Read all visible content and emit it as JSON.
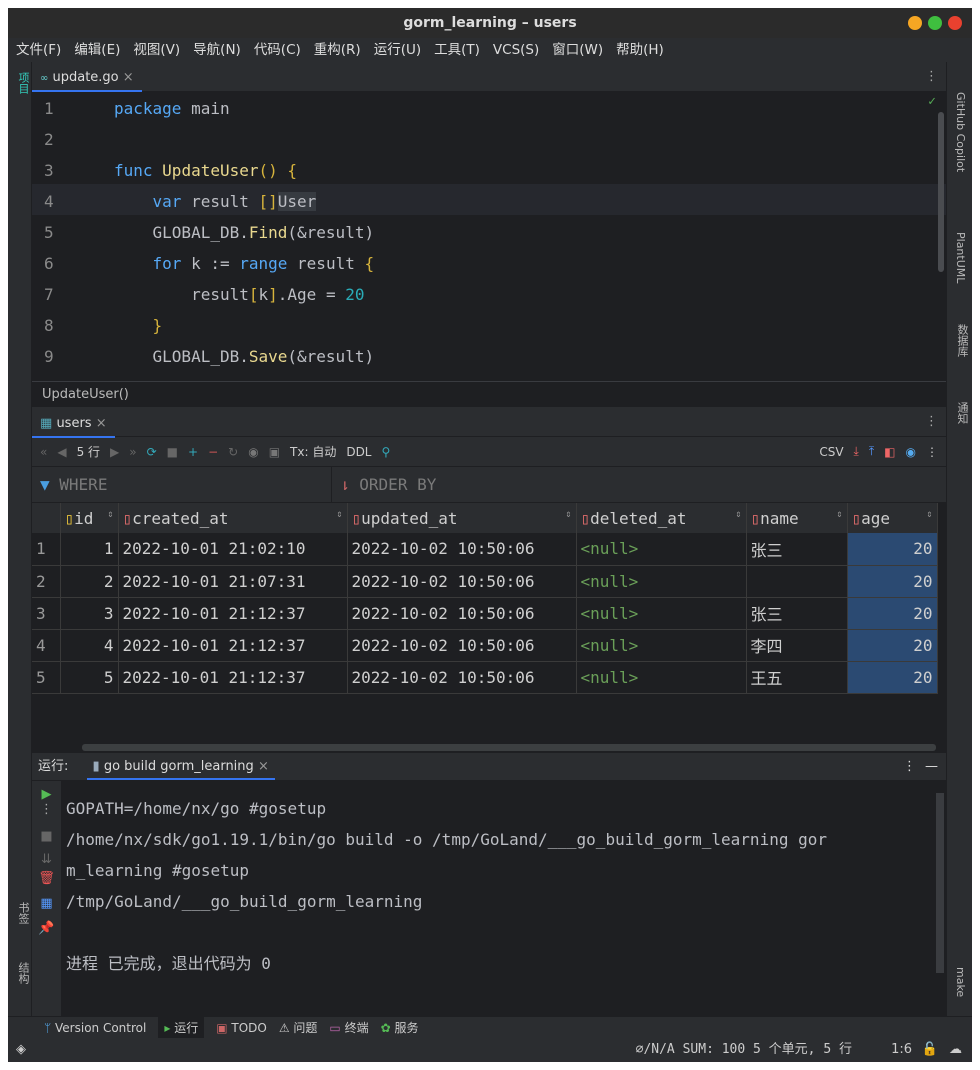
{
  "window": {
    "title": "gorm_learning – users"
  },
  "menu": [
    "文件(F)",
    "编辑(E)",
    "视图(V)",
    "导航(N)",
    "代码(C)",
    "重构(R)",
    "运行(U)",
    "工具(T)",
    "VCS(S)",
    "窗口(W)",
    "帮助(H)"
  ],
  "left_strip": {
    "project": "项目",
    "bookmarks": "书签",
    "structure": "结构"
  },
  "right_strip": {
    "copilot": "GitHub Copilot",
    "plantuml": "PlantUML",
    "database": "数据库",
    "notifications": "通知",
    "make": "make"
  },
  "editor": {
    "tab": "update.go",
    "breadcrumb": "UpdateUser()",
    "lines": [
      [
        [
          "kw",
          "package"
        ],
        [
          "p",
          " main"
        ]
      ],
      [],
      [
        [
          "kw",
          "func"
        ],
        [
          "p",
          " "
        ],
        [
          "fn",
          "UpdateUser"
        ],
        [
          "br",
          "()"
        ],
        [
          "p",
          " "
        ],
        [
          "br",
          "{"
        ]
      ],
      [
        [
          "p",
          "    "
        ],
        [
          "kw",
          "var"
        ],
        [
          "p",
          " result "
        ],
        [
          "br",
          "[]"
        ],
        [
          "hl",
          "User"
        ]
      ],
      [
        [
          "p",
          "    GLOBAL_DB."
        ],
        [
          "fn",
          "Find"
        ],
        [
          "p",
          "(&result)"
        ]
      ],
      [
        [
          "p",
          "    "
        ],
        [
          "kw",
          "for"
        ],
        [
          "p",
          " k := "
        ],
        [
          "kw",
          "range"
        ],
        [
          "p",
          " result "
        ],
        [
          "br",
          "{"
        ]
      ],
      [
        [
          "p",
          "        result"
        ],
        [
          "br",
          "["
        ],
        [
          "p",
          "k"
        ],
        [
          "br",
          "]"
        ],
        [
          "p",
          ".Age = "
        ],
        [
          "num",
          "20"
        ]
      ],
      [
        [
          "p",
          "    "
        ],
        [
          "br",
          "}"
        ]
      ],
      [
        [
          "p",
          "    GLOBAL_DB."
        ],
        [
          "fn",
          "Save"
        ],
        [
          "p",
          "(&result)"
        ]
      ]
    ]
  },
  "db": {
    "tab": "users",
    "rows_label": "5 行",
    "tx": "Tx: 自动",
    "ddl": "DDL",
    "csv": "CSV",
    "where": "WHERE",
    "order_by": "ORDER BY",
    "columns": [
      "id",
      "created_at",
      "updated_at",
      "deleted_at",
      "name",
      "age"
    ],
    "rows": [
      [
        "1",
        "1",
        "2022-10-01 21:02:10",
        "2022-10-02 10:50:06",
        "<null>",
        "张三",
        "20"
      ],
      [
        "2",
        "2",
        "2022-10-01 21:07:31",
        "2022-10-02 10:50:06",
        "<null>",
        "",
        "20"
      ],
      [
        "3",
        "3",
        "2022-10-01 21:12:37",
        "2022-10-02 10:50:06",
        "<null>",
        "张三",
        "20"
      ],
      [
        "4",
        "4",
        "2022-10-01 21:12:37",
        "2022-10-02 10:50:06",
        "<null>",
        "李四",
        "20"
      ],
      [
        "5",
        "5",
        "2022-10-01 21:12:37",
        "2022-10-02 10:50:06",
        "<null>",
        "王五",
        "20"
      ]
    ]
  },
  "run": {
    "label": "运行:",
    "tab": "go build gorm_learning",
    "output": [
      "GOPATH=/home/nx/go #gosetup",
      "/home/nx/sdk/go1.19.1/bin/go build -o /tmp/GoLand/___go_build_gorm_learning gor",
      "m_learning #gosetup",
      "/tmp/GoLand/___go_build_gorm_learning",
      "",
      "进程 已完成，退出代码为 0"
    ]
  },
  "bottom_tabs": [
    "Version Control",
    "运行",
    "TODO",
    "问题",
    "终端",
    "服务"
  ],
  "status": {
    "summary": "∅/N/A  SUM: 100  5 个单元, 5 行",
    "position": "1:6"
  }
}
